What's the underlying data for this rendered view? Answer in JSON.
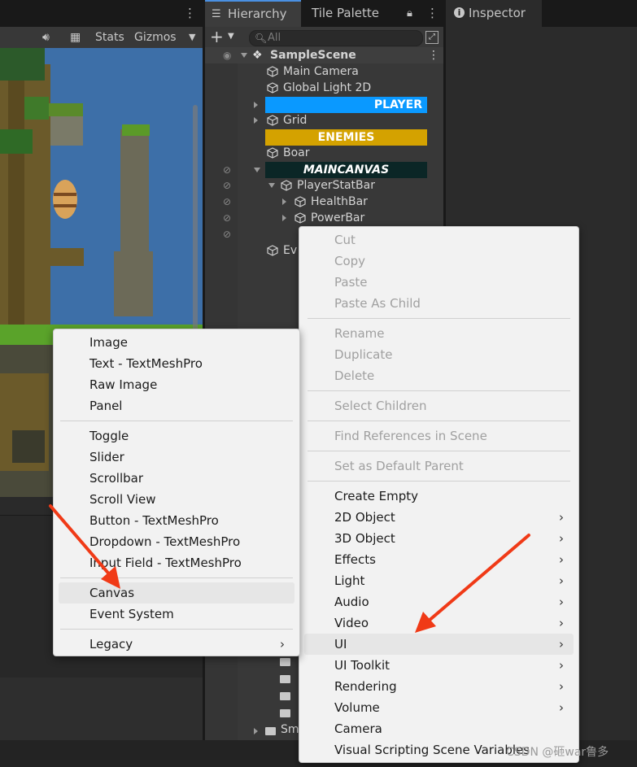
{
  "tabs": {
    "hierarchy": "Hierarchy",
    "tile_palette": "Tile Palette",
    "inspector": "Inspector"
  },
  "scene_toolbar": {
    "stats": "Stats",
    "gizmos": "Gizmos"
  },
  "hierarchy": {
    "search_placeholder": "All",
    "scene_name": "SampleScene",
    "rows": {
      "main_camera": "Main Camera",
      "global_light": "Global Light 2D",
      "player": "PLAYER",
      "grid": "Grid",
      "enemies": "ENEMIES",
      "boar": "Boar",
      "maincanvas": "MAINCANVAS",
      "player_stat_bar": "PlayerStatBar",
      "health_bar": "HealthBar",
      "power_bar": "PowerBar",
      "event_partial": "Ev",
      "folder_partial": "Sm"
    },
    "colors": {
      "player": "#0a99ff",
      "enemies": "#d4a200",
      "maincanvas": "#0b2626"
    }
  },
  "context_menu": {
    "items": {
      "cut": "Cut",
      "copy": "Copy",
      "paste": "Paste",
      "paste_as_child": "Paste As Child",
      "rename": "Rename",
      "duplicate": "Duplicate",
      "delete": "Delete",
      "select_children": "Select Children",
      "find_references": "Find References in Scene",
      "set_default_parent": "Set as Default Parent",
      "create_empty": "Create Empty",
      "obj_2d": "2D Object",
      "obj_3d": "3D Object",
      "effects": "Effects",
      "light": "Light",
      "audio": "Audio",
      "video": "Video",
      "ui": "UI",
      "ui_toolkit": "UI Toolkit",
      "rendering": "Rendering",
      "volume": "Volume",
      "camera": "Camera",
      "visual_scripting": "Visual Scripting Scene Variables"
    }
  },
  "ui_submenu": {
    "items": {
      "image": "Image",
      "text_tmp": "Text - TextMeshPro",
      "raw_image": "Raw Image",
      "panel": "Panel",
      "toggle": "Toggle",
      "slider": "Slider",
      "scrollbar": "Scrollbar",
      "scroll_view": "Scroll View",
      "button_tmp": "Button - TextMeshPro",
      "dropdown_tmp": "Dropdown - TextMeshPro",
      "input_field_tmp": "Input Field - TextMeshPro",
      "canvas": "Canvas",
      "event_system": "Event System",
      "legacy": "Legacy"
    }
  },
  "watermark": "CSDN @砸war鲁多",
  "accent": {
    "annotation_arrow": "#f03a17",
    "tab_highlight": "#4a90e2"
  }
}
